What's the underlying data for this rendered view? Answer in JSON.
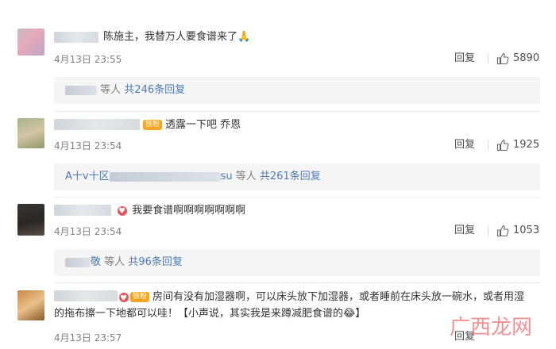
{
  "comments": [
    {
      "text": "陈施主，我替万人要食谱来了🙏",
      "date": "4月13日 23:55",
      "reply_label": "回复",
      "likes": "5890",
      "sub_replies": {
        "who_suffix": "等人",
        "count_text": "共246条回复"
      }
    },
    {
      "text": "透露一下吧  乔恩",
      "badge": "铁粉",
      "date": "4月13日 23:54",
      "reply_label": "回复",
      "likes": "1925",
      "sub_replies": {
        "name_prefix": "A十v十区",
        "name_suffix": "su",
        "who_suffix": "等人",
        "count_text": "共261条回复"
      }
    },
    {
      "text": "我要食谱啊啊啊啊啊啊啊",
      "date": "4月13日 23:54",
      "reply_label": "回复",
      "likes": "1053",
      "sub_replies": {
        "name_suffix": "敬",
        "who_suffix": "等人",
        "count_text": "共96条回复"
      }
    },
    {
      "badge": "铁粉",
      "text": "房间有没有加湿器啊，可以床头放下加湿器，或者睡前在床头放一碗水，或者用湿的拖布擦一下地都可以哇！【小声说，其实我是来蹲减肥食谱的😂】",
      "date": "4月13日 23:57",
      "reply_label": "回复"
    }
  ],
  "watermark": "广西龙网",
  "colors": {
    "link": "#4c7bb5",
    "badge": "#f5a623",
    "muted": "#808080"
  }
}
